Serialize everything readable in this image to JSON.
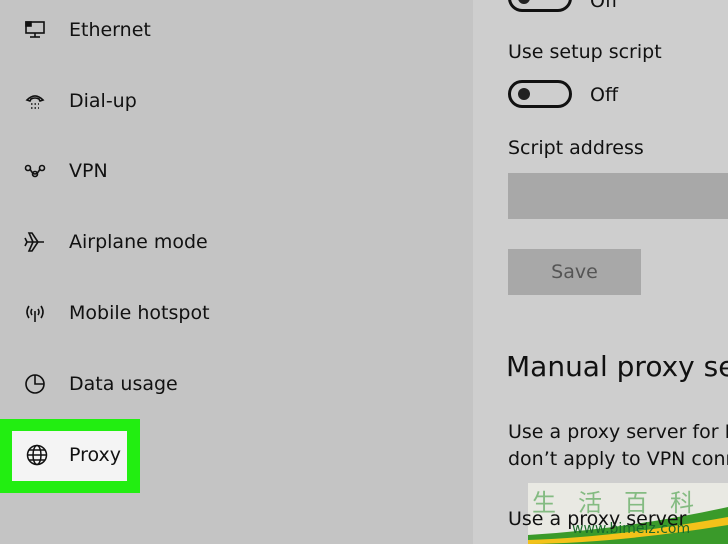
{
  "sidebar": {
    "items": [
      {
        "label": "Ethernet",
        "icon": "ethernet-icon"
      },
      {
        "label": "Dial-up",
        "icon": "dialup-icon"
      },
      {
        "label": "VPN",
        "icon": "vpn-icon"
      },
      {
        "label": "Airplane mode",
        "icon": "airplane-icon"
      },
      {
        "label": "Mobile hotspot",
        "icon": "hotspot-icon"
      },
      {
        "label": "Data usage",
        "icon": "data-usage-icon"
      },
      {
        "label": "Proxy",
        "icon": "globe-icon"
      }
    ],
    "highlight_color": "#22ee11"
  },
  "main": {
    "top_toggle_state": "Off",
    "setup_script_label": "Use setup script",
    "setup_script_state": "Off",
    "script_address_label": "Script address",
    "save_label": "Save",
    "manual_heading": "Manual proxy set",
    "manual_desc_1": "Use a proxy server for Et",
    "manual_desc_2": "don’t apply to VPN conn",
    "use_proxy_label": "Use a proxy server"
  },
  "watermark": {
    "chars": "生活百科",
    "url": "www.bimeiz.com"
  }
}
